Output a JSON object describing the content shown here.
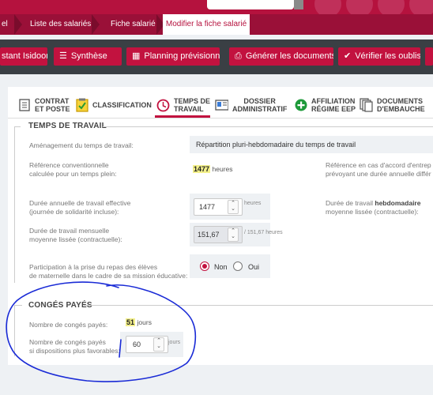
{
  "breadcrumb": {
    "items": [
      "el",
      "Liste des salariés",
      "Fiche salarié"
    ],
    "active": "Modifier la fiche salarié"
  },
  "actions": {
    "employee_name": "stant Isidoor",
    "synthese": "Synthèse",
    "planning": "Planning prévisionnel",
    "generer": "Générer les documents",
    "verifier": "Vérifier les oublis"
  },
  "tabs": [
    {
      "line1": "CONTRAT",
      "line2": "ET POSTE",
      "icon": "contract-icon"
    },
    {
      "line1": "CLASSIFICATION",
      "line2": "",
      "icon": "checklist-icon"
    },
    {
      "line1": "TEMPS DE",
      "line2": "TRAVAIL",
      "icon": "clock-icon"
    },
    {
      "line1": "DOSSIER",
      "line2": "ADMINISTRATIF",
      "icon": "id-card-icon"
    },
    {
      "line1": "AFFILIATION",
      "line2": "RÉGIME EEP",
      "icon": "plus-circle-icon"
    },
    {
      "line1": "DOCUMENTS",
      "line2": "D'EMBAUCHE",
      "icon": "documents-icon"
    }
  ],
  "temps": {
    "title": "TEMPS DE TRAVAIL",
    "amenagement_label": "Aménagement du temps de travail:",
    "amenagement_value": "Répartition pluri-hebdomadaire du temps de travail",
    "ref_label_1": "Référence conventionnelle",
    "ref_label_2": "calculée pour un temps plein:",
    "ref_value": "1477",
    "ref_unit": "heures",
    "ref_right_1": "Référence en cas d'accord d'entrep",
    "ref_right_2": "prévoyant une durée annuelle différ",
    "duree_label_1": "Durée annuelle de travail effective",
    "duree_label_2": "(journée de solidarité incluse):",
    "duree_value": "1477",
    "duree_unit": "heures",
    "hebdo_label_1a": "Durée de travail ",
    "hebdo_label_1b": "hebdomadaire",
    "hebdo_label_2": "moyenne lissée (contractuelle):",
    "mens_label_1": "Durée de travail mensuelle",
    "mens_label_2": "moyenne lissée (contractuelle):",
    "mens_value": "151,67",
    "mens_unit": "/ 151,67 heures",
    "repas_label_1": "Participation à la prise du repas des élèves",
    "repas_label_2": "de maternelle dans le cadre de sa mission éducative:",
    "repas_non": "Non",
    "repas_oui": "Oui"
  },
  "conges": {
    "title": "CONGÉS PAYÉS",
    "nb_label": "Nombre de congés payés:",
    "nb_value": "51",
    "nb_unit": "jours",
    "fav_label_1": "Nombre de congés payés",
    "fav_label_2": "si dispositions plus favorables:",
    "fav_value": "60",
    "fav_unit": "jours"
  },
  "colors": {
    "brand": "#c2123f",
    "annotation": "#1a2bd6",
    "highlight": "#f3f08a"
  }
}
